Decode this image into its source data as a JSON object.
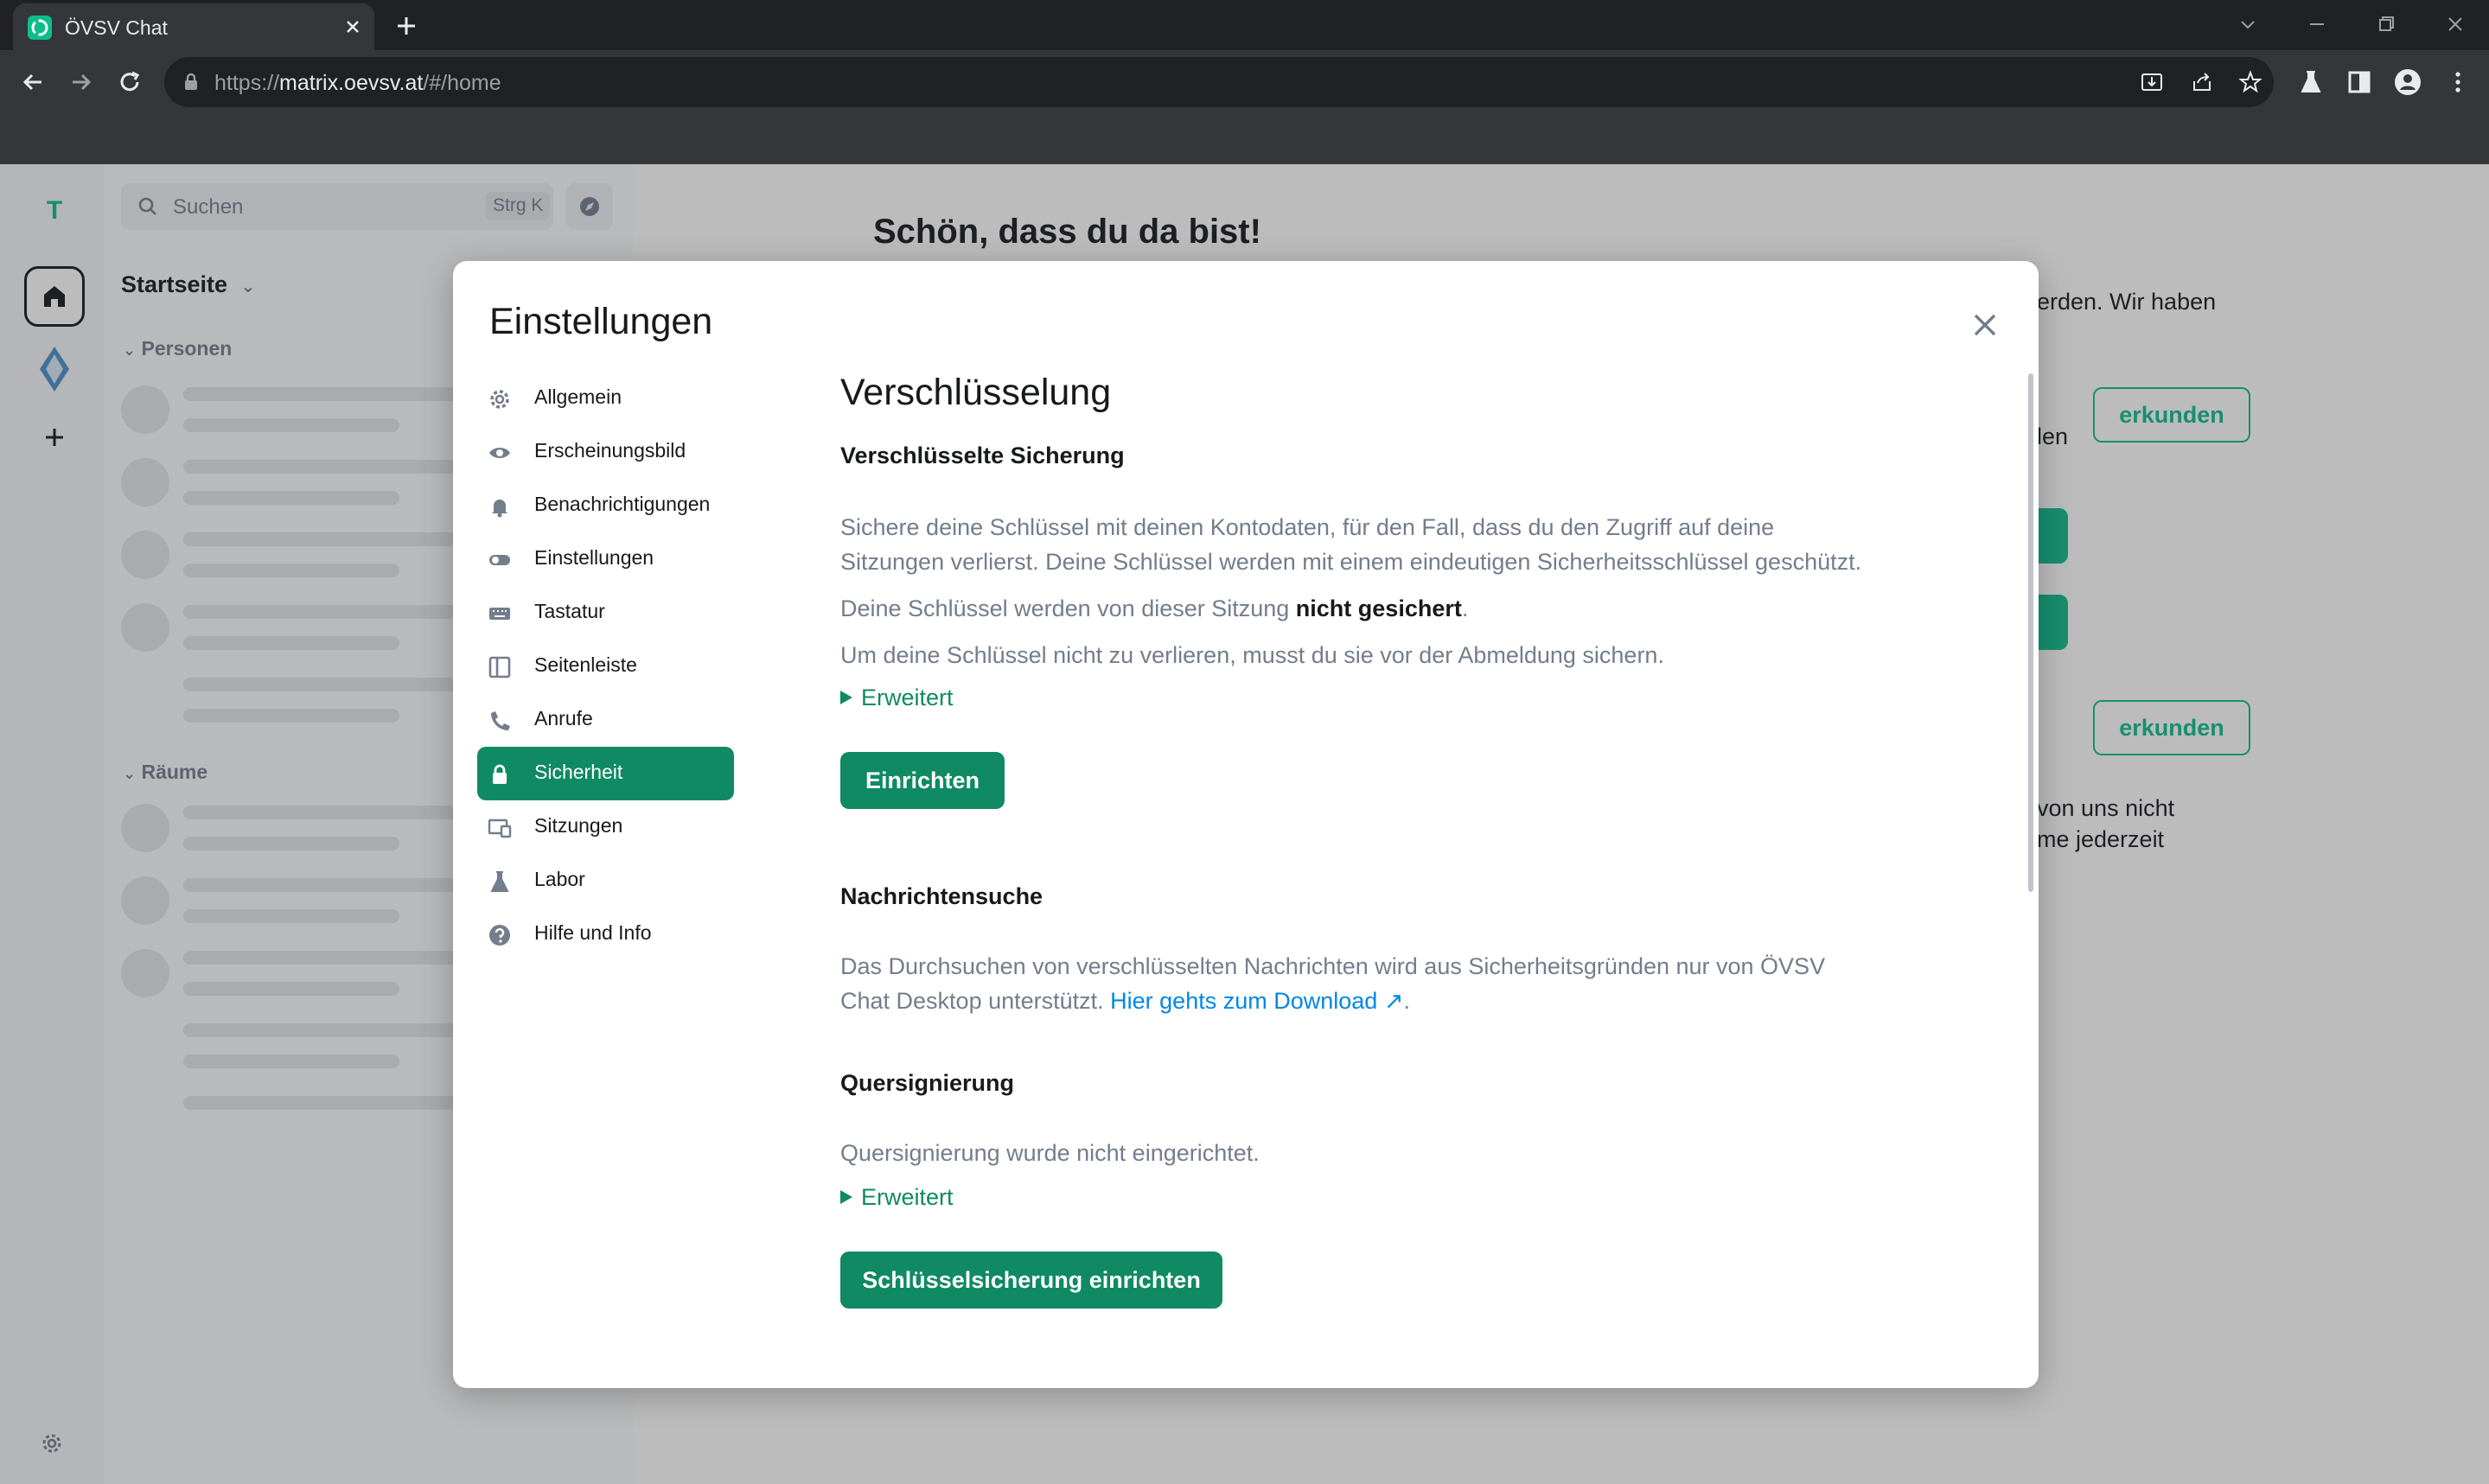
{
  "browser": {
    "tab_title": "ÖVSV Chat",
    "url_scheme": "https://",
    "url_host": "matrix.oevsv.at",
    "url_path": "/#/home"
  },
  "roomlist": {
    "search_placeholder": "Suchen",
    "search_shortcut": "Strg K",
    "home_label": "Startseite",
    "section_people": "Personen",
    "section_rooms": "Räume"
  },
  "spacebar": {
    "avatar_letter": "T"
  },
  "home": {
    "title": "Schön, dass du da bist!",
    "text_1": "erden. Wir haben",
    "text_2": "len",
    "text_3": "von uns nicht",
    "text_4": "me jederzeit",
    "explore_label_1": "erkunden",
    "explore_label_2": "erkunden"
  },
  "dialog": {
    "title": "Einstellungen",
    "nav": [
      {
        "label": "Allgemein",
        "icon": "gear-icon"
      },
      {
        "label": "Erscheinungsbild",
        "icon": "eye-icon"
      },
      {
        "label": "Benachrichtigungen",
        "icon": "bell-icon"
      },
      {
        "label": "Einstellungen",
        "icon": "toggle-icon"
      },
      {
        "label": "Tastatur",
        "icon": "keyboard-icon"
      },
      {
        "label": "Seitenleiste",
        "icon": "sidebar-icon"
      },
      {
        "label": "Anrufe",
        "icon": "phone-icon"
      },
      {
        "label": "Sicherheit",
        "icon": "lock-icon",
        "active": true
      },
      {
        "label": "Sitzungen",
        "icon": "devices-icon"
      },
      {
        "label": "Labor",
        "icon": "flask-icon"
      },
      {
        "label": "Hilfe und Info",
        "icon": "help-icon"
      }
    ],
    "accent_color": "#0f8a62",
    "content": {
      "heading": "Verschlüsselung",
      "backup_heading": "Verschlüsselte Sicherung",
      "backup_text_1": "Sichere deine Schlüssel mit deinen Kontodaten, für den Fall, dass du den Zugriff auf deine Sitzungen verlierst. Deine Schlüssel werden mit einem eindeutigen Sicherheitsschlüssel geschützt.",
      "backup_status_prefix": "Deine Schlüssel werden von dieser Sitzung ",
      "backup_status_bold": "nicht gesichert",
      "backup_status_suffix": ".",
      "backup_text_3": "Um deine Schlüssel nicht zu verlieren, musst du sie vor der Abmeldung sichern.",
      "advanced_label_1": "Erweitert",
      "setup_button": "Einrichten",
      "search_heading": "Nachrichtensuche",
      "search_text": "Das Durchsuchen von verschlüsselten Nachrichten wird aus Sicherheitsgründen nur von ÖVSV Chat Desktop unterstützt. ",
      "search_link": "Hier gehts zum Download",
      "search_text_end": ".",
      "cross_heading": "Quersignierung",
      "cross_text": "Quersignierung wurde nicht eingerichtet.",
      "advanced_label_2": "Erweitert",
      "key_backup_button": "Schlüsselsicherung einrichten"
    }
  }
}
